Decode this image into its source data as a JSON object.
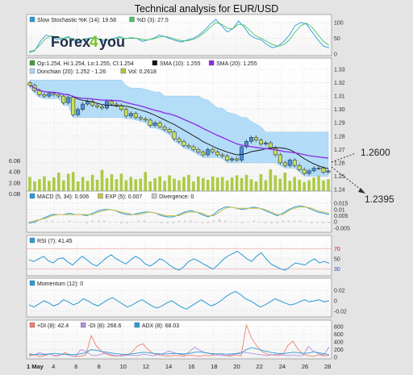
{
  "title": "Technical analysis for EUR/USD",
  "brand": {
    "text_a": "Forex",
    "text_b": "4",
    "text_c": "you"
  },
  "annotations": {
    "upper": "1.2600",
    "lower": "1.2395"
  },
  "chart_data": [
    {
      "id": "stochastic",
      "type": "line",
      "legend": [
        "Slow Stochastic %K (14): 19.58",
        "%D (3): 27.5"
      ],
      "colors": [
        "#2a9ad8",
        "#46c46a"
      ],
      "ylim": [
        0,
        110
      ],
      "yticks": [
        0,
        50,
        100
      ],
      "series": [
        {
          "name": "Slow Stochastic %K (14): 19.58",
          "values": [
            5,
            10,
            40,
            60,
            55,
            45,
            50,
            55,
            42,
            40,
            48,
            52,
            50,
            40,
            45,
            50,
            55,
            48,
            52,
            50,
            40,
            45,
            50,
            60,
            55,
            48,
            42,
            38,
            45,
            50,
            60,
            75,
            95,
            110,
            90,
            70,
            80,
            105,
            85,
            60,
            50,
            45,
            30,
            20,
            25,
            40,
            60,
            90,
            100,
            95,
            70,
            45,
            25,
            19.58
          ]
        },
        {
          "name": "%D (3): 27.5",
          "values": [
            8,
            12,
            30,
            50,
            58,
            52,
            50,
            52,
            48,
            44,
            46,
            50,
            50,
            45,
            45,
            48,
            52,
            50,
            50,
            50,
            46,
            45,
            48,
            54,
            56,
            52,
            46,
            42,
            42,
            46,
            55,
            68,
            85,
            100,
            95,
            82,
            80,
            95,
            92,
            75,
            58,
            50,
            40,
            30,
            25,
            30,
            45,
            70,
            90,
            98,
            85,
            62,
            40,
            27.5
          ]
        }
      ]
    },
    {
      "id": "price",
      "type": "candlestick",
      "legend": [
        "Op:1.254, Hi:1.254, Lo:1.255, Cl:1.254",
        "SMA (10): 1.255",
        "SMA (20): 1.255",
        "Donchian (20): 1.252 - 1.26",
        "Vol: 0.2618"
      ],
      "colors": {
        "up": "#4a90e0",
        "down": "#c8e05a",
        "sma10": "#111111",
        "sma20": "#8a2be2",
        "donchian": "#a8d8f8",
        "volume": "#a8c838"
      },
      "ylim": [
        1.24,
        1.33
      ],
      "yticks": [
        1.24,
        1.25,
        1.26,
        1.27,
        1.28,
        1.29,
        1.3,
        1.31,
        1.32,
        1.33
      ],
      "volume_ticks": [
        "0.0B",
        "2.0B",
        "4.0B",
        "6.0B"
      ],
      "volume_max": 6.0,
      "close": [
        1.318,
        1.314,
        1.311,
        1.31,
        1.312,
        1.311,
        1.31,
        1.305,
        1.309,
        1.296,
        1.3,
        1.304,
        1.306,
        1.303,
        1.302,
        1.301,
        1.306,
        1.304,
        1.303,
        1.3,
        1.295,
        1.297,
        1.294,
        1.293,
        1.292,
        1.288,
        1.29,
        1.287,
        1.285,
        1.283,
        1.278,
        1.276,
        1.273,
        1.272,
        1.27,
        1.268,
        1.266,
        1.27,
        1.268,
        1.266,
        1.265,
        1.262,
        1.263,
        1.262,
        1.272,
        1.276,
        1.279,
        1.277,
        1.274,
        1.275,
        1.271,
        1.266,
        1.26,
        1.258,
        1.262,
        1.258,
        1.255,
        1.252,
        1.254,
        1.256,
        1.256,
        1.253,
        1.254
      ],
      "volume": [
        3.0,
        2.2,
        2.6,
        3.1,
        2.3,
        2.9,
        3.8,
        2.4,
        3.6,
        3.9,
        2.2,
        3.0,
        2.3,
        3.4,
        2.5,
        4.3,
        2.8,
        3.5,
        2.6,
        3.6,
        2.4,
        3.0,
        2.6,
        2.7,
        3.9,
        2.2,
        2.8,
        3.1,
        2.3,
        3.3,
        2.7,
        2.4,
        3.0,
        3.4,
        2.2,
        3.1,
        2.8,
        2.5,
        3.1,
        2.9,
        3.0,
        2.4,
        2.9,
        3.3,
        2.8,
        3.4,
        2.6,
        2.2,
        3.5,
        2.4,
        4.4,
        3.3,
        2.7,
        3.8,
        2.3,
        3.0,
        2.5,
        2.1,
        2.4,
        2.9,
        3.5,
        2.4,
        2.6
      ]
    },
    {
      "id": "macd",
      "type": "line+bar",
      "legend": [
        "MACD (5, 34): 0.006",
        "EXP (5): 0.007",
        "Divergence: 0"
      ],
      "colors": [
        "#2a9ad8",
        "#c8c04a",
        "#c8c8c8"
      ],
      "ylim": [
        -0.007,
        0.017
      ],
      "yticks": [
        -0.005,
        0,
        0.005,
        0.01,
        0.015
      ],
      "series": [
        {
          "name": "MACD (5, 34): 0.006",
          "values": [
            -0.001,
            0.0,
            0.002,
            0.004,
            0.006,
            0.006,
            0.006,
            0.007,
            0.006,
            0.006,
            0.005,
            0.007,
            0.009,
            0.01,
            0.01,
            0.009,
            0.007,
            0.006,
            0.006,
            0.007,
            0.008,
            0.008,
            0.007,
            0.005,
            0.004,
            0.004,
            0.006,
            0.008,
            0.009,
            0.008,
            0.006,
            0.004,
            0.006,
            0.01,
            0.012,
            0.012,
            0.011,
            0.01,
            0.011,
            0.012,
            0.011,
            0.009,
            0.007,
            0.005,
            0.007,
            0.01,
            0.012,
            0.013,
            0.012,
            0.01,
            0.008,
            0.007,
            0.006
          ]
        },
        {
          "name": "EXP (5): 0.007",
          "values": [
            0.0,
            0.001,
            0.002,
            0.003,
            0.005,
            0.006,
            0.006,
            0.006,
            0.006,
            0.006,
            0.006,
            0.006,
            0.008,
            0.009,
            0.01,
            0.009,
            0.008,
            0.007,
            0.006,
            0.006,
            0.007,
            0.008,
            0.007,
            0.006,
            0.005,
            0.005,
            0.005,
            0.007,
            0.008,
            0.008,
            0.007,
            0.005,
            0.005,
            0.008,
            0.011,
            0.012,
            0.011,
            0.011,
            0.011,
            0.011,
            0.011,
            0.01,
            0.008,
            0.006,
            0.006,
            0.009,
            0.011,
            0.012,
            0.012,
            0.011,
            0.009,
            0.008,
            0.007
          ]
        },
        {
          "name": "Divergence: 0",
          "values": [
            -0.001,
            -0.001,
            0.0,
            0.001,
            0.001,
            0.0,
            0.0,
            0.001,
            0.0,
            0.0,
            -0.001,
            0.001,
            0.001,
            0.001,
            0.0,
            0.0,
            -0.001,
            -0.001,
            0.0,
            0.001,
            0.001,
            0.0,
            0.0,
            -0.001,
            -0.001,
            -0.001,
            0.001,
            0.001,
            0.001,
            0.0,
            -0.001,
            -0.001,
            0.001,
            0.002,
            0.001,
            0.0,
            0.0,
            -0.001,
            0.0,
            0.001,
            0.0,
            -0.001,
            -0.001,
            -0.001,
            0.001,
            0.001,
            0.001,
            0.001,
            0.0,
            -0.001,
            -0.001,
            -0.001,
            -0.001
          ]
        }
      ]
    },
    {
      "id": "rsi",
      "type": "line",
      "legend": [
        "RSI (7): 41.45"
      ],
      "colors": [
        "#2a9ad8"
      ],
      "ylim": [
        20,
        80
      ],
      "yticks": [
        30,
        50,
        70
      ],
      "levels": [
        30,
        70
      ],
      "series": [
        {
          "name": "RSI (7): 41.45",
          "values": [
            48,
            45,
            50,
            55,
            46,
            42,
            50,
            52,
            44,
            38,
            47,
            55,
            48,
            40,
            36,
            44,
            52,
            58,
            50,
            45,
            40,
            48,
            55,
            50,
            40,
            36,
            42,
            50,
            46,
            38,
            32,
            28,
            35,
            45,
            50,
            46,
            40,
            35,
            30,
            38,
            48,
            55,
            60,
            65,
            58,
            50,
            45,
            55,
            62,
            50,
            40,
            35,
            30,
            28,
            35,
            42,
            40,
            38,
            45,
            50,
            42,
            45,
            41.45
          ]
        }
      ]
    },
    {
      "id": "momentum",
      "type": "line",
      "legend": [
        "Momentum (12): 0"
      ],
      "colors": [
        "#2a9ad8"
      ],
      "ylim": [
        -0.028,
        0.028
      ],
      "yticks": [
        -0.02,
        0,
        0.02
      ],
      "series": [
        {
          "name": "Momentum (12): 0",
          "values": [
            -0.008,
            -0.012,
            -0.006,
            0.0,
            -0.004,
            -0.01,
            -0.006,
            0.002,
            -0.002,
            -0.008,
            -0.004,
            0.004,
            0.0,
            -0.006,
            -0.01,
            -0.004,
            0.002,
            0.006,
            0.0,
            -0.006,
            -0.012,
            -0.008,
            -0.002,
            0.002,
            -0.004,
            -0.01,
            -0.014,
            -0.01,
            -0.004,
            0.0,
            -0.006,
            -0.012,
            -0.016,
            -0.01,
            -0.004,
            0.002,
            -0.004,
            -0.01,
            -0.006,
            0.0,
            0.008,
            0.014,
            0.018,
            0.012,
            0.004,
            0.0,
            -0.006,
            -0.012,
            -0.008,
            -0.002,
            0.004,
            0.0,
            -0.004,
            -0.008,
            -0.006,
            -0.002,
            0.002,
            -0.002,
            0.0,
            0.002,
            -0.002,
            0.0
          ]
        }
      ]
    },
    {
      "id": "dmi",
      "type": "line",
      "legend": [
        "+DI (8): 42.4",
        "-DI (8): 266.6",
        "ADX (8): 68.03"
      ],
      "colors": [
        "#f08070",
        "#b090e0",
        "#2a9ad8"
      ],
      "ylim": [
        0,
        880
      ],
      "yticks": [
        0,
        200,
        400,
        600,
        800
      ],
      "series": [
        {
          "name": "+DI (8): 42.4",
          "values": [
            30,
            60,
            20,
            40,
            90,
            30,
            50,
            120,
            40,
            20,
            30,
            60,
            560,
            300,
            150,
            80,
            40,
            30,
            60,
            50,
            150,
            300,
            350,
            200,
            100,
            60,
            40,
            30,
            50,
            40,
            30,
            60,
            40,
            30,
            50,
            40,
            60,
            100,
            40,
            30,
            60,
            40,
            840,
            500,
            300,
            150,
            80,
            60,
            40,
            60,
            300,
            420,
            200,
            80,
            40,
            30,
            60,
            40,
            42.4
          ]
        },
        {
          "name": "-DI (8): 266.6",
          "values": [
            100,
            60,
            120,
            80,
            90,
            40,
            60,
            80,
            40,
            30,
            200,
            150,
            60,
            40,
            80,
            100,
            60,
            40,
            30,
            60,
            50,
            40,
            80,
            60,
            40,
            70,
            100,
            160,
            120,
            80,
            60,
            140,
            260,
            180,
            120,
            90,
            60,
            50,
            40,
            60,
            90,
            140,
            120,
            100,
            80,
            60,
            40,
            60,
            80,
            60,
            40,
            60,
            40,
            50,
            280,
            150,
            90,
            60,
            266.6
          ]
        },
        {
          "name": "ADX (8): 68.03",
          "values": [
            60,
            70,
            80,
            65,
            90,
            100,
            85,
            80,
            75,
            70,
            90,
            120,
            200,
            180,
            150,
            130,
            110,
            90,
            80,
            75,
            90,
            110,
            130,
            120,
            100,
            90,
            80,
            90,
            100,
            95,
            85,
            100,
            130,
            140,
            120,
            100,
            90,
            85,
            80,
            85,
            95,
            100,
            200,
            250,
            220,
            180,
            150,
            120,
            100,
            95,
            110,
            130,
            120,
            100,
            110,
            140,
            120,
            90,
            68.03
          ]
        }
      ]
    }
  ],
  "x_axis": {
    "labels": [
      "1 May",
      "4",
      "6",
      "8",
      "10",
      "12",
      "14",
      "16",
      "18",
      "20",
      "22",
      "24",
      "26",
      "28"
    ]
  }
}
